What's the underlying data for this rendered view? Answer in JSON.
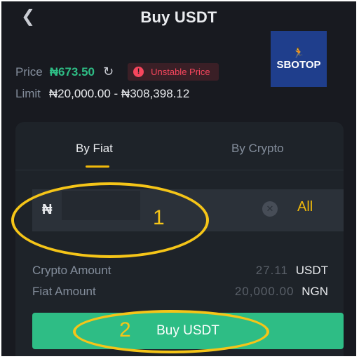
{
  "header": {
    "back_icon": "chevron-left-icon",
    "title": "Buy USDT"
  },
  "logo": {
    "text": "SBOTOP",
    "bg_color": "#1f3e8c"
  },
  "price": {
    "label": "Price",
    "value": "₦673.50",
    "refresh_icon": "refresh-icon",
    "unstable_badge": "Unstable Price",
    "unstable_color": "#f6465d"
  },
  "limit": {
    "label": "Limit",
    "value": "₦20,000.00 - ₦308,398.12"
  },
  "tabs": [
    {
      "label": "By Fiat",
      "active": true
    },
    {
      "label": "By Crypto",
      "active": false
    }
  ],
  "amount_input": {
    "currency_symbol": "₦",
    "value": "",
    "all_label": "All"
  },
  "crypto_amount": {
    "label": "Crypto Amount",
    "value_obscured": "27.11",
    "unit": "USDT"
  },
  "fiat_amount": {
    "label": "Fiat Amount",
    "value_obscured": "20,000.00",
    "unit": "NGN"
  },
  "buy_button": {
    "label": "Buy USDT",
    "color": "#2ebd85"
  },
  "annotations": {
    "one": "1",
    "two": "2",
    "color": "#f5c518"
  },
  "colors": {
    "bg": "#181a20",
    "card": "#1e2329",
    "accent": "#f0b90b"
  }
}
